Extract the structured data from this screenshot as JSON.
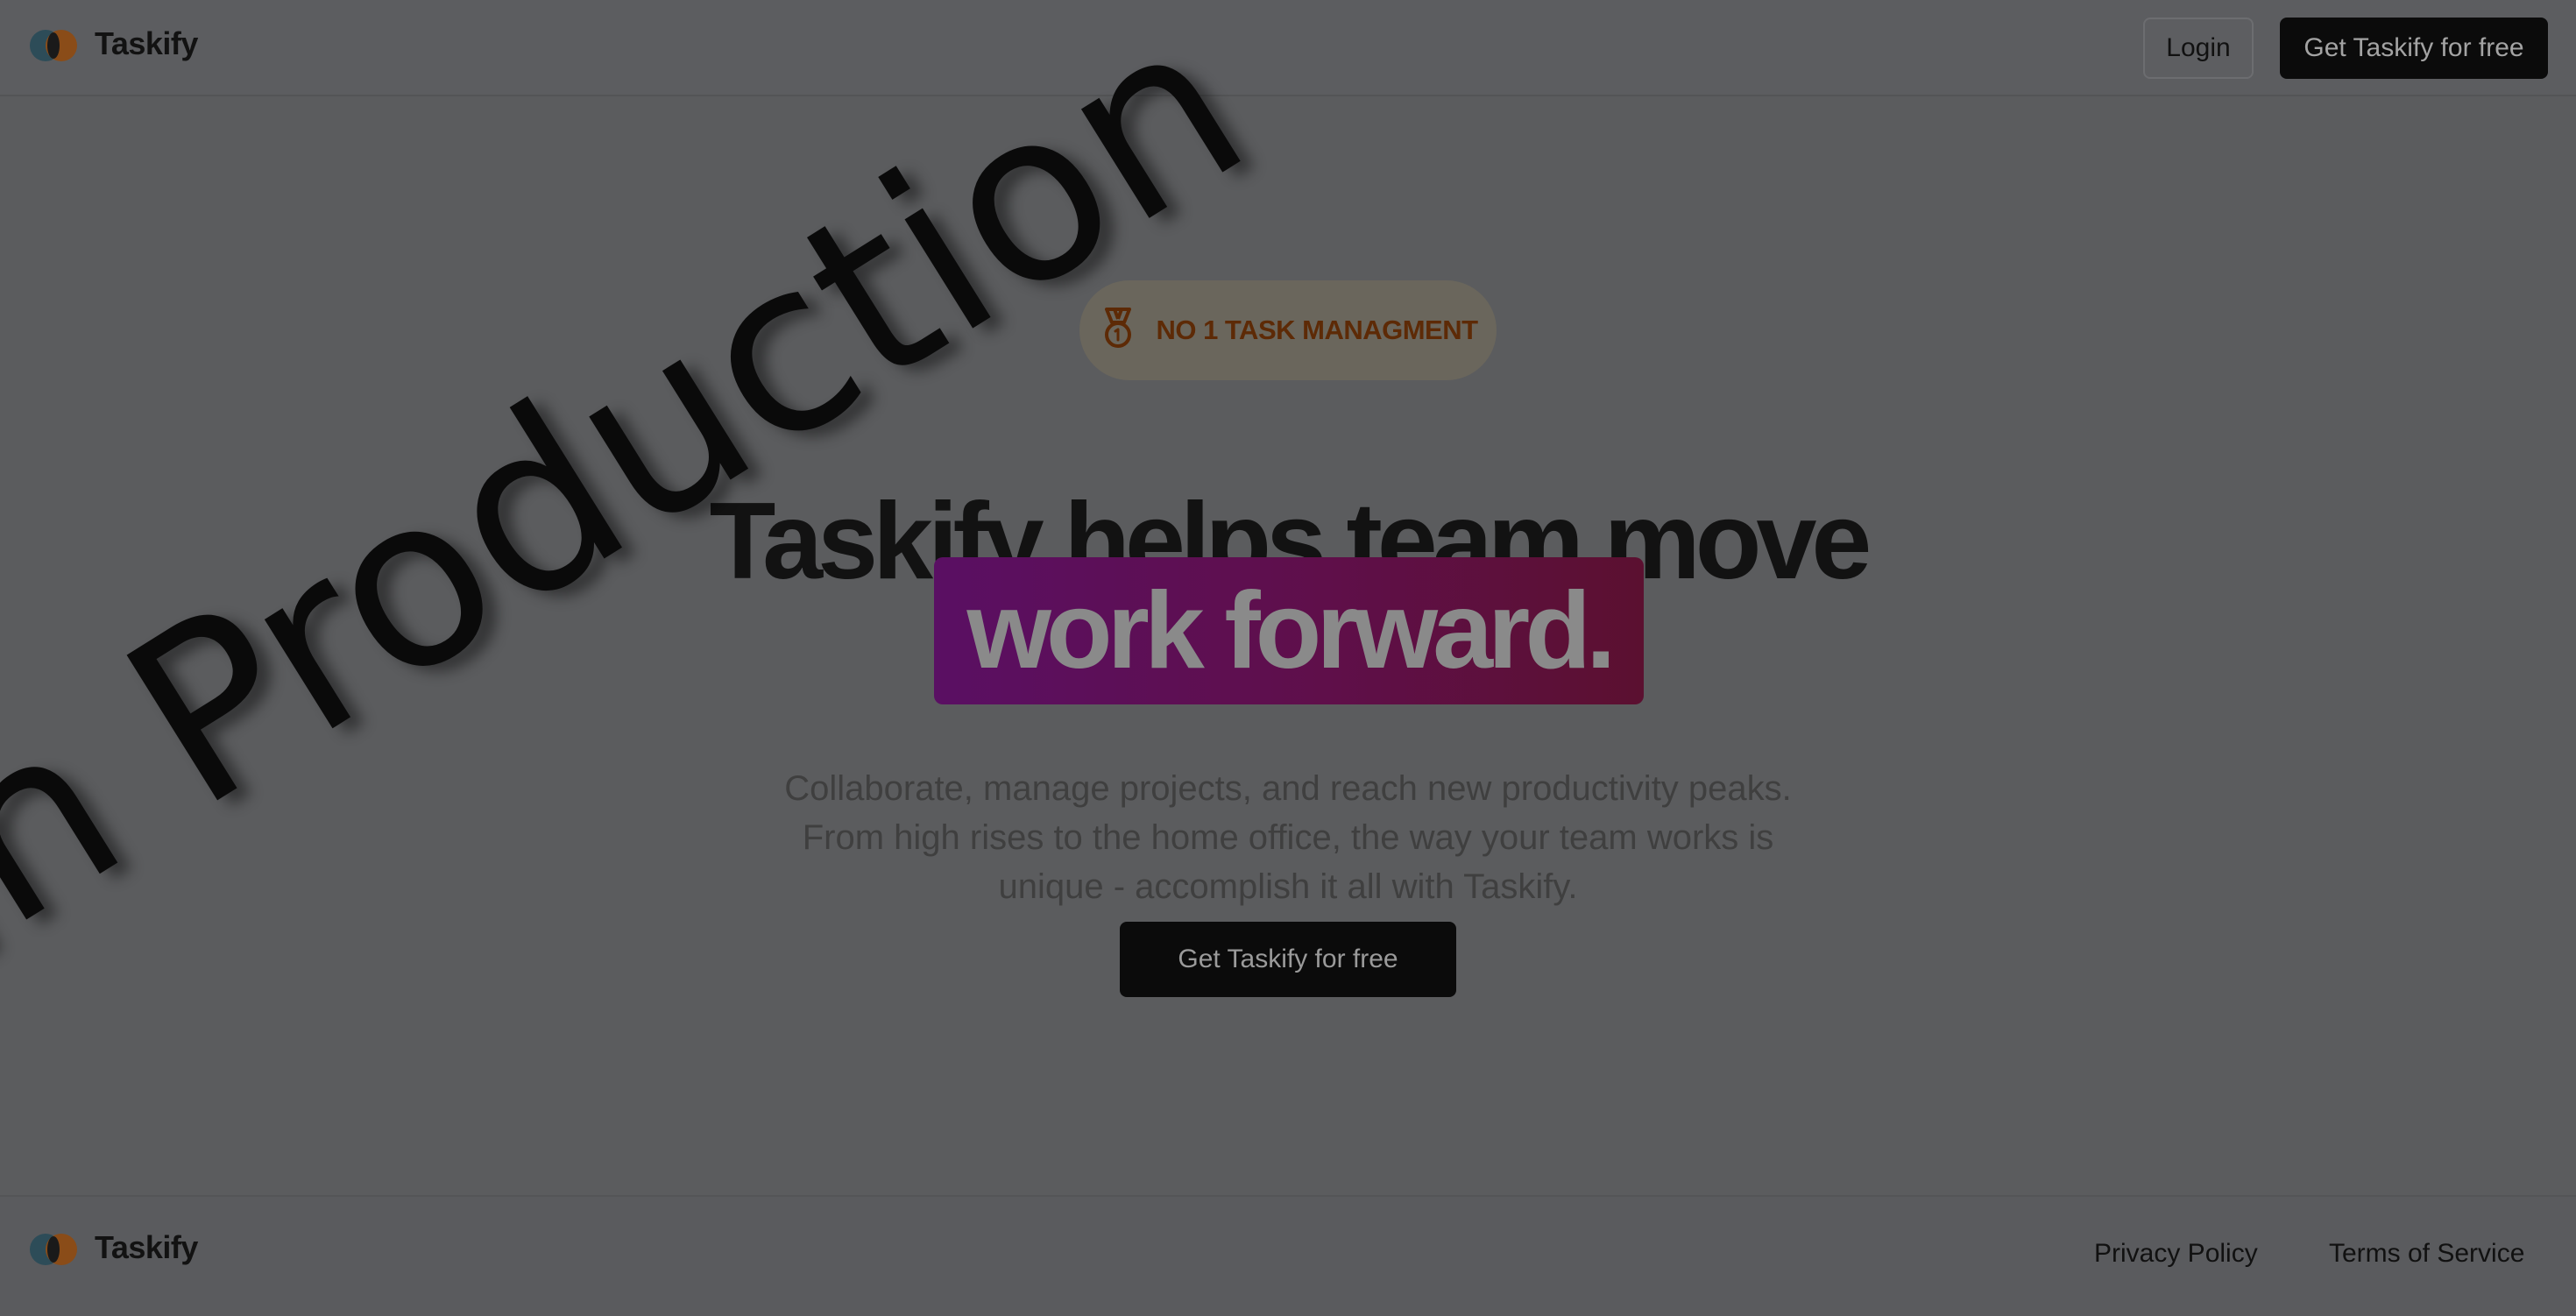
{
  "app": {
    "name": "Taskify"
  },
  "header": {
    "login_label": "Login",
    "cta_label": "Get Taskify for free"
  },
  "hero": {
    "badge_icon": "medal-icon",
    "badge_text": "NO 1 TASK MANAGMENT",
    "headline_line1": "Taskify helps team move",
    "headline_highlight": "work forward.",
    "description_lines": [
      "Collaborate, manage projects, and reach new productivity peaks.",
      "From high rises to the home office, the way your team works is",
      "unique - accomplish it all with Taskify."
    ],
    "cta_label": "Get Taskify for free"
  },
  "footer": {
    "privacy_label": "Privacy Policy",
    "terms_label": "Terms of Service"
  },
  "watermark": {
    "text": "In Production"
  },
  "colors": {
    "overlay_bg": "#5b5c5e",
    "dark_button": "#0b0b0b",
    "badge_text": "#5d2a06",
    "highlight_start": "#5a0f63",
    "highlight_end": "#5b1030"
  }
}
